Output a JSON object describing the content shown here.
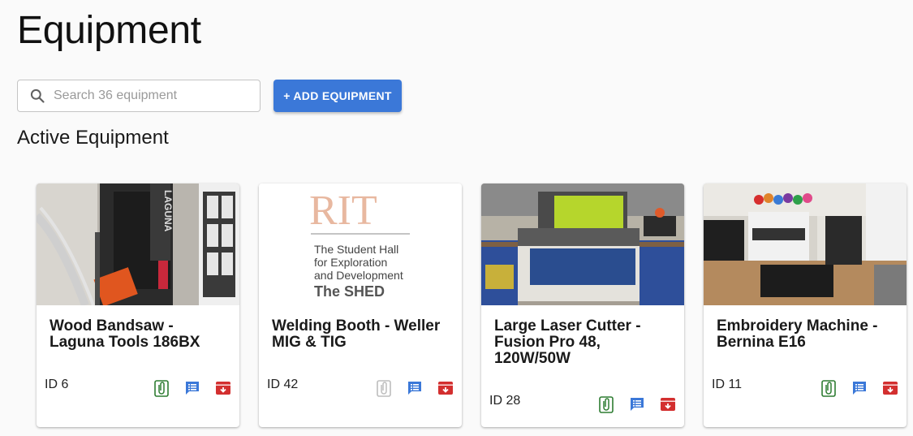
{
  "page": {
    "title": "Equipment"
  },
  "search": {
    "placeholder": "Search 36 equipment"
  },
  "toolbar": {
    "add_label": "+ ADD EQUIPMENT"
  },
  "section": {
    "title": "Active Equipment"
  },
  "colors": {
    "accent": "#3b78d8",
    "attachment_active": "#2e7d32",
    "attachment_disabled": "#bdbdbd",
    "notes": "#3b78d8",
    "archive": "#d32f2f"
  },
  "placeholder_image": {
    "logo_text": "RIT",
    "line1": "The Student Hall",
    "line2": "for Exploration",
    "line3": "and Development",
    "brand": "The SHED"
  },
  "cards": [
    {
      "title": "Wood Bandsaw - Laguna Tools 186BX",
      "id_label": "ID 6",
      "image": "bandsaw-photo",
      "attachment_enabled": true
    },
    {
      "title": "Welding Booth - Weller MIG & TIG",
      "id_label": "ID 42",
      "image": "rit-shed-logo",
      "attachment_enabled": false
    },
    {
      "title": "Large Laser Cutter - Fusion Pro 48, 120W/50W",
      "id_label": "ID 28",
      "image": "laser-cutter-photo",
      "attachment_enabled": true
    },
    {
      "title": "Embroidery Machine - Bernina E16",
      "id_label": "ID 11",
      "image": "embroidery-machine-photo",
      "attachment_enabled": true
    }
  ]
}
